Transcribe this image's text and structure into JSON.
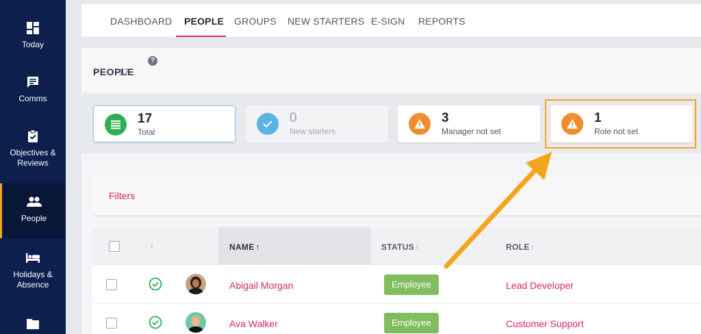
{
  "sidebar": {
    "items": [
      {
        "label": "Today"
      },
      {
        "label": "Comms"
      },
      {
        "label": "Objectives & Reviews"
      },
      {
        "label": "People"
      },
      {
        "label": "Holidays & Absence"
      }
    ],
    "active_accent": "#f5a524"
  },
  "tabs": [
    "DASHBOARD",
    "PEOPLE",
    "GROUPS",
    "NEW STARTERS",
    "E-SIGN",
    "REPORTS"
  ],
  "people": {
    "title": "PEOPLE",
    "count": "17",
    "help": "?"
  },
  "stats": [
    {
      "value": "17",
      "label": "Total",
      "icon": "list-icon",
      "color": "#2fae52"
    },
    {
      "value": "0",
      "label": "New starters",
      "icon": "check-icon",
      "color": "#5bb3e6"
    },
    {
      "value": "3",
      "label": "Manager not set",
      "icon": "warning-icon",
      "color": "#f28b2d"
    },
    {
      "value": "1",
      "label": "Role not set",
      "icon": "warning-icon",
      "color": "#f28b2d"
    }
  ],
  "filters": {
    "label": "Filters"
  },
  "table": {
    "columns": {
      "name": "NAME",
      "status": "STATUS",
      "role": "ROLE"
    },
    "rows": [
      {
        "name": "Abigail Morgan",
        "status": "Employee",
        "role": "Lead Developer"
      },
      {
        "name": "Ava Walker",
        "status": "Employee",
        "role": "Customer Support"
      }
    ]
  },
  "colors": {
    "brand_pink": "#d6246e",
    "sidebar_bg": "#0c1f4d",
    "annotation_orange": "#f5a51d",
    "status_green": "#80bd5f"
  }
}
